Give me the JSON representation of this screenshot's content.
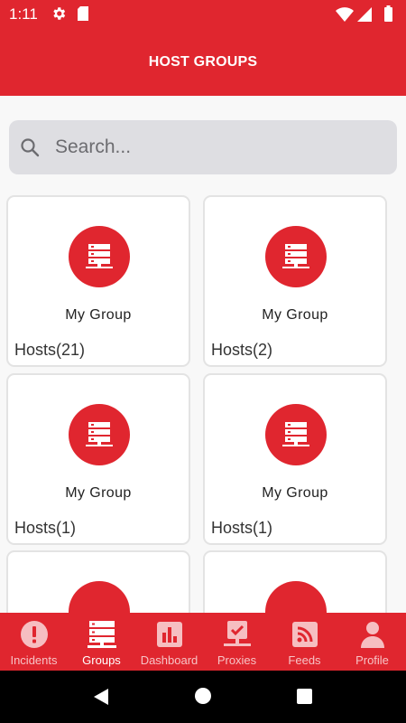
{
  "status_bar": {
    "time": "1:11"
  },
  "header": {
    "title": "HOST GROUPS"
  },
  "search": {
    "placeholder": "Search..."
  },
  "groups": [
    {
      "name": "My Group",
      "hosts_label": "Hosts(21)"
    },
    {
      "name": "My Group",
      "hosts_label": "Hosts(2)"
    },
    {
      "name": "My Group",
      "hosts_label": "Hosts(1)"
    },
    {
      "name": "My Group",
      "hosts_label": "Hosts(1)"
    }
  ],
  "bottom_nav": {
    "items": [
      {
        "label": "Incidents",
        "icon": "alert-icon",
        "active": false
      },
      {
        "label": "Groups",
        "icon": "server-stack-icon",
        "active": true
      },
      {
        "label": "Dashboard",
        "icon": "bar-chart-icon",
        "active": false
      },
      {
        "label": "Proxies",
        "icon": "proxy-check-icon",
        "active": false
      },
      {
        "label": "Feeds",
        "icon": "rss-icon",
        "active": false
      },
      {
        "label": "Profile",
        "icon": "person-icon",
        "active": false
      }
    ]
  },
  "colors": {
    "accent": "#e0262f",
    "background": "#f8f8f8",
    "search_bg": "#dedee2"
  }
}
